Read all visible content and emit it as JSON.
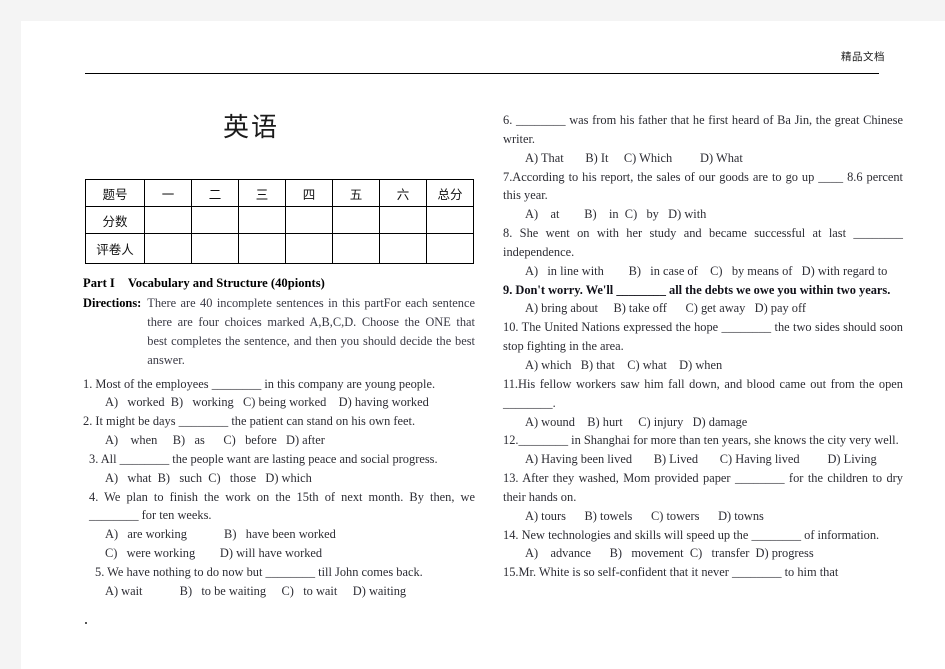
{
  "page": {
    "header_mark": "精品文档",
    "title": "英语"
  },
  "score_table": {
    "rows": [
      {
        "label": "题号",
        "cells": [
          "一",
          "二",
          "三",
          "四",
          "五",
          "六",
          "总分"
        ]
      },
      {
        "label": "分数",
        "cells": [
          "",
          "",
          "",
          "",
          "",
          "",
          ""
        ]
      },
      {
        "label": "评卷人",
        "cells": [
          "",
          "",
          "",
          "",
          "",
          "",
          ""
        ]
      }
    ]
  },
  "part": {
    "name": "Part I",
    "title": "Vocabulary and Structure (40pionts)",
    "directions_label": "Directions:",
    "directions_text": "There are 40 incomplete sentences in this partFor each sentence there are four choices marked A,B,C,D. Choose the ONE that best completes the sentence, and then you should decide the best answer."
  },
  "left_column": {
    "questions": [
      {
        "stem": "1. Most of the employees ________ in this company are young people.",
        "options": "A)   worked  B)   working   C) being worked    D) having worked"
      },
      {
        "stem": "2. It might be days ________ the patient can stand on his own feet.",
        "options": "A)    when     B)   as      C)   before   D) after"
      },
      {
        "stem": "3. All ________ the people want are lasting peace and social progress.",
        "options": "A)   what  B)   such  C)   those   D) which"
      },
      {
        "stem": "4. We plan to finish the work on the 15th of next month. By then, we ________ for ten weeks.",
        "options_line_1": "A)   are working            B)   have been worked",
        "options_line_2": "C)   were working        D) will have worked"
      },
      {
        "stem": "5. We have nothing to do now but ________ till John comes back.",
        "options": "A) wait            B)   to be waiting     C)   to wait     D) waiting"
      }
    ]
  },
  "right_column": {
    "questions": [
      {
        "stem": "6. ________ was from his father that he first heard of Ba Jin, the great Chinese writer.",
        "options": "A) That       B) It     C) Which         D) What"
      },
      {
        "stem": "7.According to his report, the sales of our goods are to go up ____ 8.6 percent this year.",
        "options": "A)    at        B)    in  C)   by   D) with"
      },
      {
        "stem": "8. She went on with her study and became successful at last ________ independence.",
        "options": "A)   in line with        B)   in case of    C)   by means of   D) with regard to"
      },
      {
        "stem": "9. Don't worry. We'll ________ all the debts we owe you within two years.",
        "options": "A) bring about     B) take off      C) get away   D) pay off"
      },
      {
        "stem": "10. The United Nations expressed the hope ________ the two sides should soon stop fighting in the area.",
        "options": "A) which   B) that    C) what    D) when"
      },
      {
        "stem": "11.His fellow workers saw him fall down, and blood came out from the open ________.",
        "options": "A) wound    B) hurt     C) injury   D) damage"
      },
      {
        "stem": "12.________ in Shanghai for more than ten years, she knows the city very well.",
        "options": "A) Having been lived       B) Lived       C) Having lived         D) Living"
      },
      {
        "stem": "13. After they washed, Mom provided paper ________ for the children to dry their hands on.",
        "options": "A) tours      B) towels      C) towers      D) towns"
      },
      {
        "stem": "14. New technologies and skills will speed up the ________ of information.",
        "options": "A)    advance      B)   movement  C)   transfer  D) progress"
      },
      {
        "stem": "15.Mr. White is so self-confident that it never ________ to him that",
        "options": ""
      }
    ]
  }
}
